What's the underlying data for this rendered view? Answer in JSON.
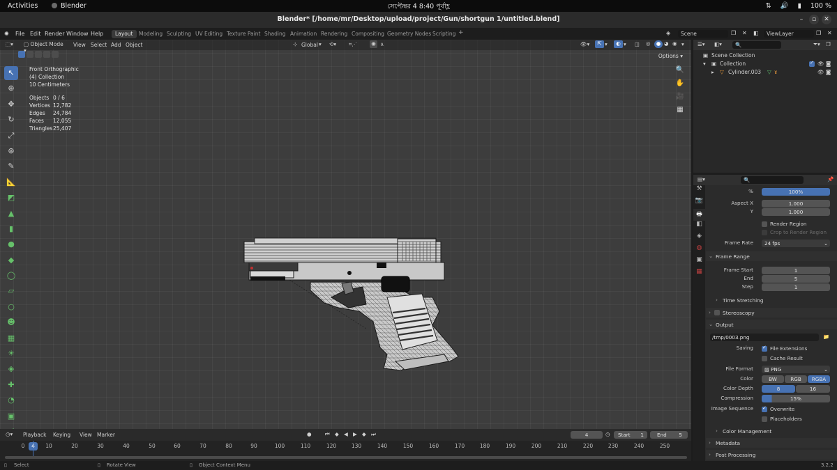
{
  "topbar": {
    "activities": "Activities",
    "app": "Blender",
    "clock": "সেপ্টেম্বর 4  8:40 পূর্বাহ্ণ",
    "battery": "100 %"
  },
  "window": {
    "title": "Blender* [/home/mr/Desktop/upload/project/Gun/shortgun 1/untitled.blend]"
  },
  "menu": {
    "items": [
      "File",
      "Edit",
      "Render",
      "Window",
      "Help"
    ],
    "workspaces": [
      "Layout",
      "Modeling",
      "Sculpting",
      "UV Editing",
      "Texture Paint",
      "Shading",
      "Animation",
      "Rendering",
      "Compositing",
      "Geometry Nodes",
      "Scripting"
    ],
    "active_workspace": "Layout",
    "add_tab": "+",
    "scene": "Scene",
    "view_layer": "ViewLayer"
  },
  "viewport": {
    "mode": "Object Mode",
    "menus": [
      "View",
      "Select",
      "Add",
      "Object"
    ],
    "transform_orientation": "Global",
    "options": "Options",
    "overlay": {
      "view": "Front Orthographic",
      "collection": "(4) Collection",
      "scale": "10 Centimeters"
    },
    "stats": [
      {
        "label": "Objects",
        "value": "0 / 6"
      },
      {
        "label": "Vertices",
        "value": "12,782"
      },
      {
        "label": "Edges",
        "value": "24,784"
      },
      {
        "label": "Faces",
        "value": "12,055"
      },
      {
        "label": "Triangles",
        "value": "25,407"
      }
    ]
  },
  "timeline": {
    "menus": [
      "Playback",
      "Keying",
      "View",
      "Marker"
    ],
    "current_frame": "4",
    "start_label": "Start",
    "start": "1",
    "end_label": "End",
    "end": "5",
    "ticks": [
      "0",
      "10",
      "20",
      "30",
      "40",
      "50",
      "60",
      "70",
      "80",
      "90",
      "100",
      "110",
      "120",
      "130",
      "140",
      "150",
      "160",
      "170",
      "180",
      "190",
      "200",
      "210",
      "220",
      "230",
      "240",
      "250"
    ],
    "playhead": "4"
  },
  "statusbar": {
    "select": "Select",
    "rotate": "Rotate View",
    "context": "Object Context Menu",
    "version": "3.2.2"
  },
  "outliner": {
    "scene_collection": "Scene Collection",
    "collection": "Collection",
    "object": "Cylinder.003"
  },
  "properties": {
    "percent_label": "%",
    "percent": "100%",
    "aspect_x_label": "Aspect X",
    "aspect_x": "1.000",
    "aspect_y_label": "Y",
    "aspect_y": "1.000",
    "render_region": "Render Region",
    "crop_region": "Crop to Render Region",
    "frame_rate_label": "Frame Rate",
    "frame_rate": "24 fps",
    "frame_range": "Frame Range",
    "frame_start_label": "Frame Start",
    "frame_start": "1",
    "end_label": "End",
    "end": "5",
    "step_label": "Step",
    "step": "1",
    "time_stretching": "Time Stretching",
    "stereoscopy": "Stereoscopy",
    "output": "Output",
    "output_path": "/tmp/0003.png",
    "saving_label": "Saving",
    "file_extensions": "File Extensions",
    "cache_result": "Cache Result",
    "file_format_label": "File Format",
    "file_format": "PNG",
    "color_label": "Color",
    "color_bw": "BW",
    "color_rgb": "RGB",
    "color_rgba": "RGBA",
    "color_depth_label": "Color Depth",
    "depth_8": "8",
    "depth_16": "16",
    "compression_label": "Compression",
    "compression": "15%",
    "image_sequence_label": "Image Sequence",
    "overwrite": "Overwrite",
    "placeholders": "Placeholders",
    "color_management": "Color Management",
    "metadata": "Metadata",
    "post_processing": "Post Processing"
  }
}
